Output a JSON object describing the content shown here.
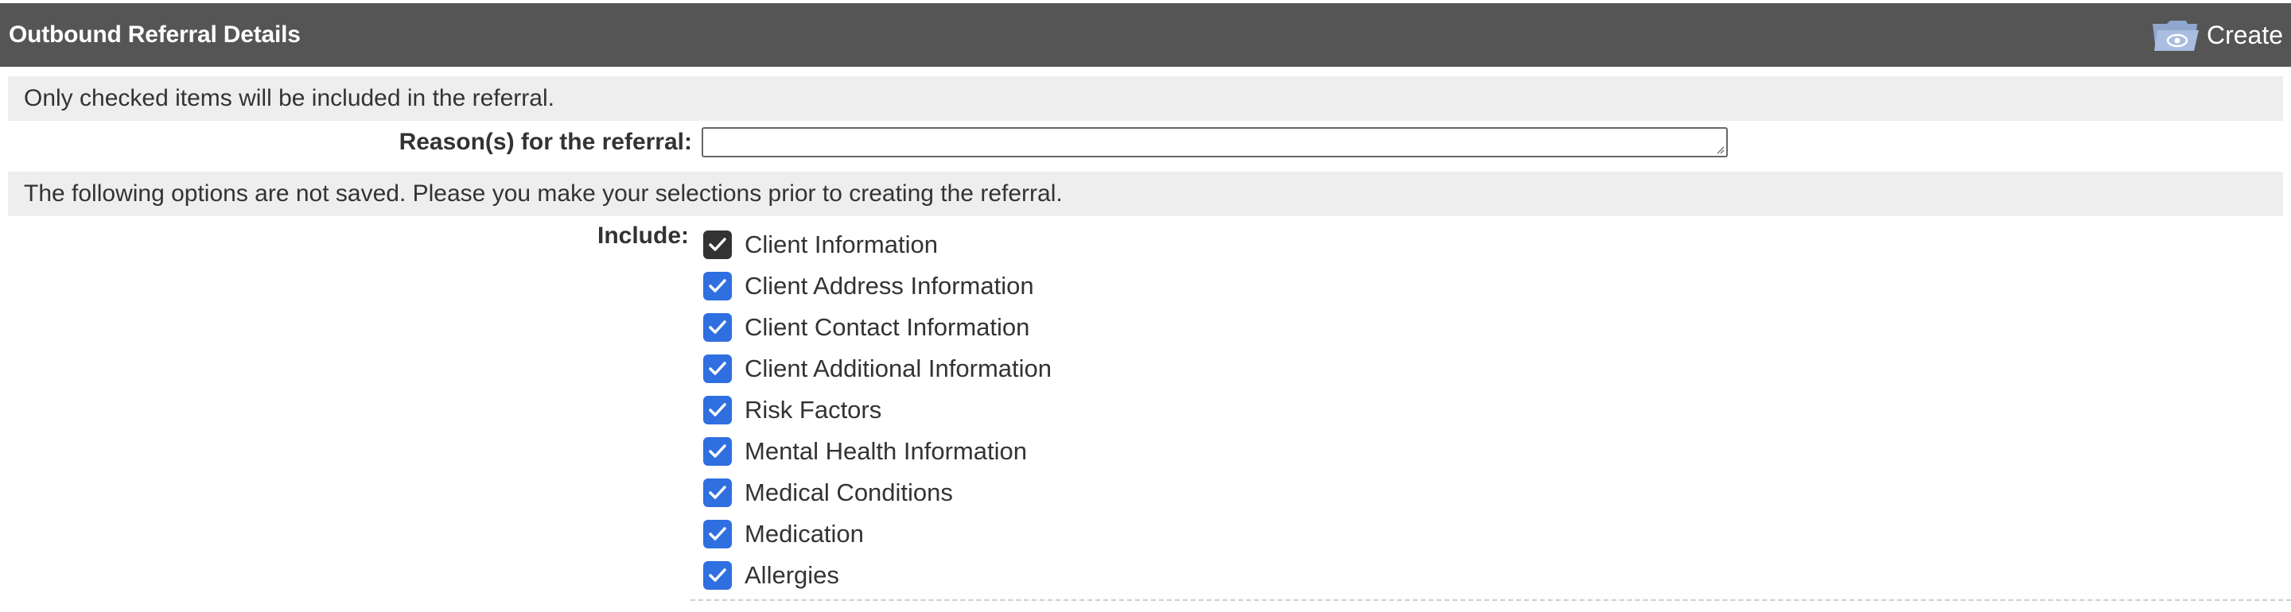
{
  "header": {
    "title": "Outbound Referral Details",
    "create_label": "Create",
    "create_icon": "folder-eye-icon"
  },
  "notice_checked": "Only checked items will be included in the referral.",
  "reason": {
    "label": "Reason(s) for the referral:",
    "value": ""
  },
  "notice_not_saved": "The following options are not saved. Please you make your selections prior to creating the referral.",
  "include": {
    "label": "Include:",
    "options": [
      {
        "label": "Client Information",
        "checked": true
      },
      {
        "label": "Client Address Information",
        "checked": true
      },
      {
        "label": "Client Contact Information",
        "checked": true
      },
      {
        "label": "Client Additional Information",
        "checked": true
      },
      {
        "label": "Risk Factors",
        "checked": true
      },
      {
        "label": "Mental Health Information",
        "checked": true
      },
      {
        "label": "Medical Conditions",
        "checked": true
      },
      {
        "label": "Medication",
        "checked": true
      },
      {
        "label": "Allergies",
        "checked": true
      }
    ]
  },
  "colors": {
    "header_bg": "#555555",
    "info_bar_bg": "#eeeeee",
    "checkbox_checked": "#2f6fe0",
    "checkbox_focused": "#333333"
  }
}
